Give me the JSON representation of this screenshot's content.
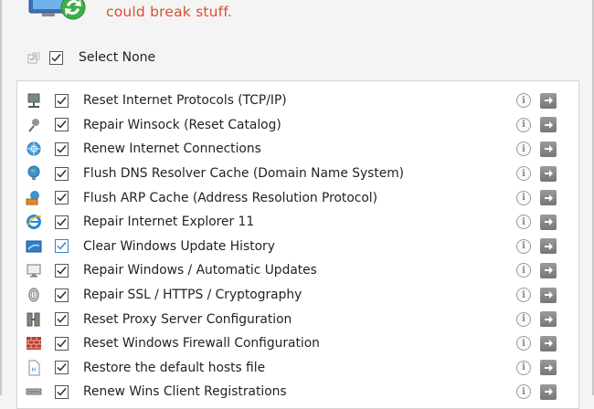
{
  "header": {
    "warning_text": "could break stuff."
  },
  "select_all": {
    "label": "Select None",
    "checked": true
  },
  "rows": [
    {
      "label": "Reset Internet Protocols (TCP/IP)",
      "icon": "network-icon",
      "checked": true
    },
    {
      "label": "Repair Winsock (Reset Catalog)",
      "icon": "winsock-icon",
      "checked": true
    },
    {
      "label": "Renew Internet Connections",
      "icon": "connection-globe-icon",
      "checked": true
    },
    {
      "label": "Flush DNS Resolver Cache (Domain Name System)",
      "icon": "dns-globe-icon",
      "checked": true
    },
    {
      "label": "Flush ARP Cache (Address Resolution Protocol)",
      "icon": "arp-icon",
      "checked": true
    },
    {
      "label": "Repair Internet Explorer 11",
      "icon": "internet-explorer-icon",
      "checked": true
    },
    {
      "label": "Clear Windows Update History",
      "icon": "update-history-icon",
      "checked": true
    },
    {
      "label": "Repair Windows / Automatic Updates",
      "icon": "monitor-icon",
      "checked": true
    },
    {
      "label": "Repair SSL / HTTPS / Cryptography",
      "icon": "fingerprint-icon",
      "checked": true
    },
    {
      "label": "Reset Proxy Server Configuration",
      "icon": "proxy-server-icon",
      "checked": true
    },
    {
      "label": "Reset Windows Firewall Configuration",
      "icon": "firewall-icon",
      "checked": true
    },
    {
      "label": "Restore the default hosts file",
      "icon": "hosts-file-icon",
      "checked": true
    },
    {
      "label": "Renew Wins Client Registrations",
      "icon": "wins-icon",
      "checked": true
    }
  ],
  "colors": {
    "warning": "#d9502c",
    "checkbox_blue": "#3b7fd1"
  }
}
